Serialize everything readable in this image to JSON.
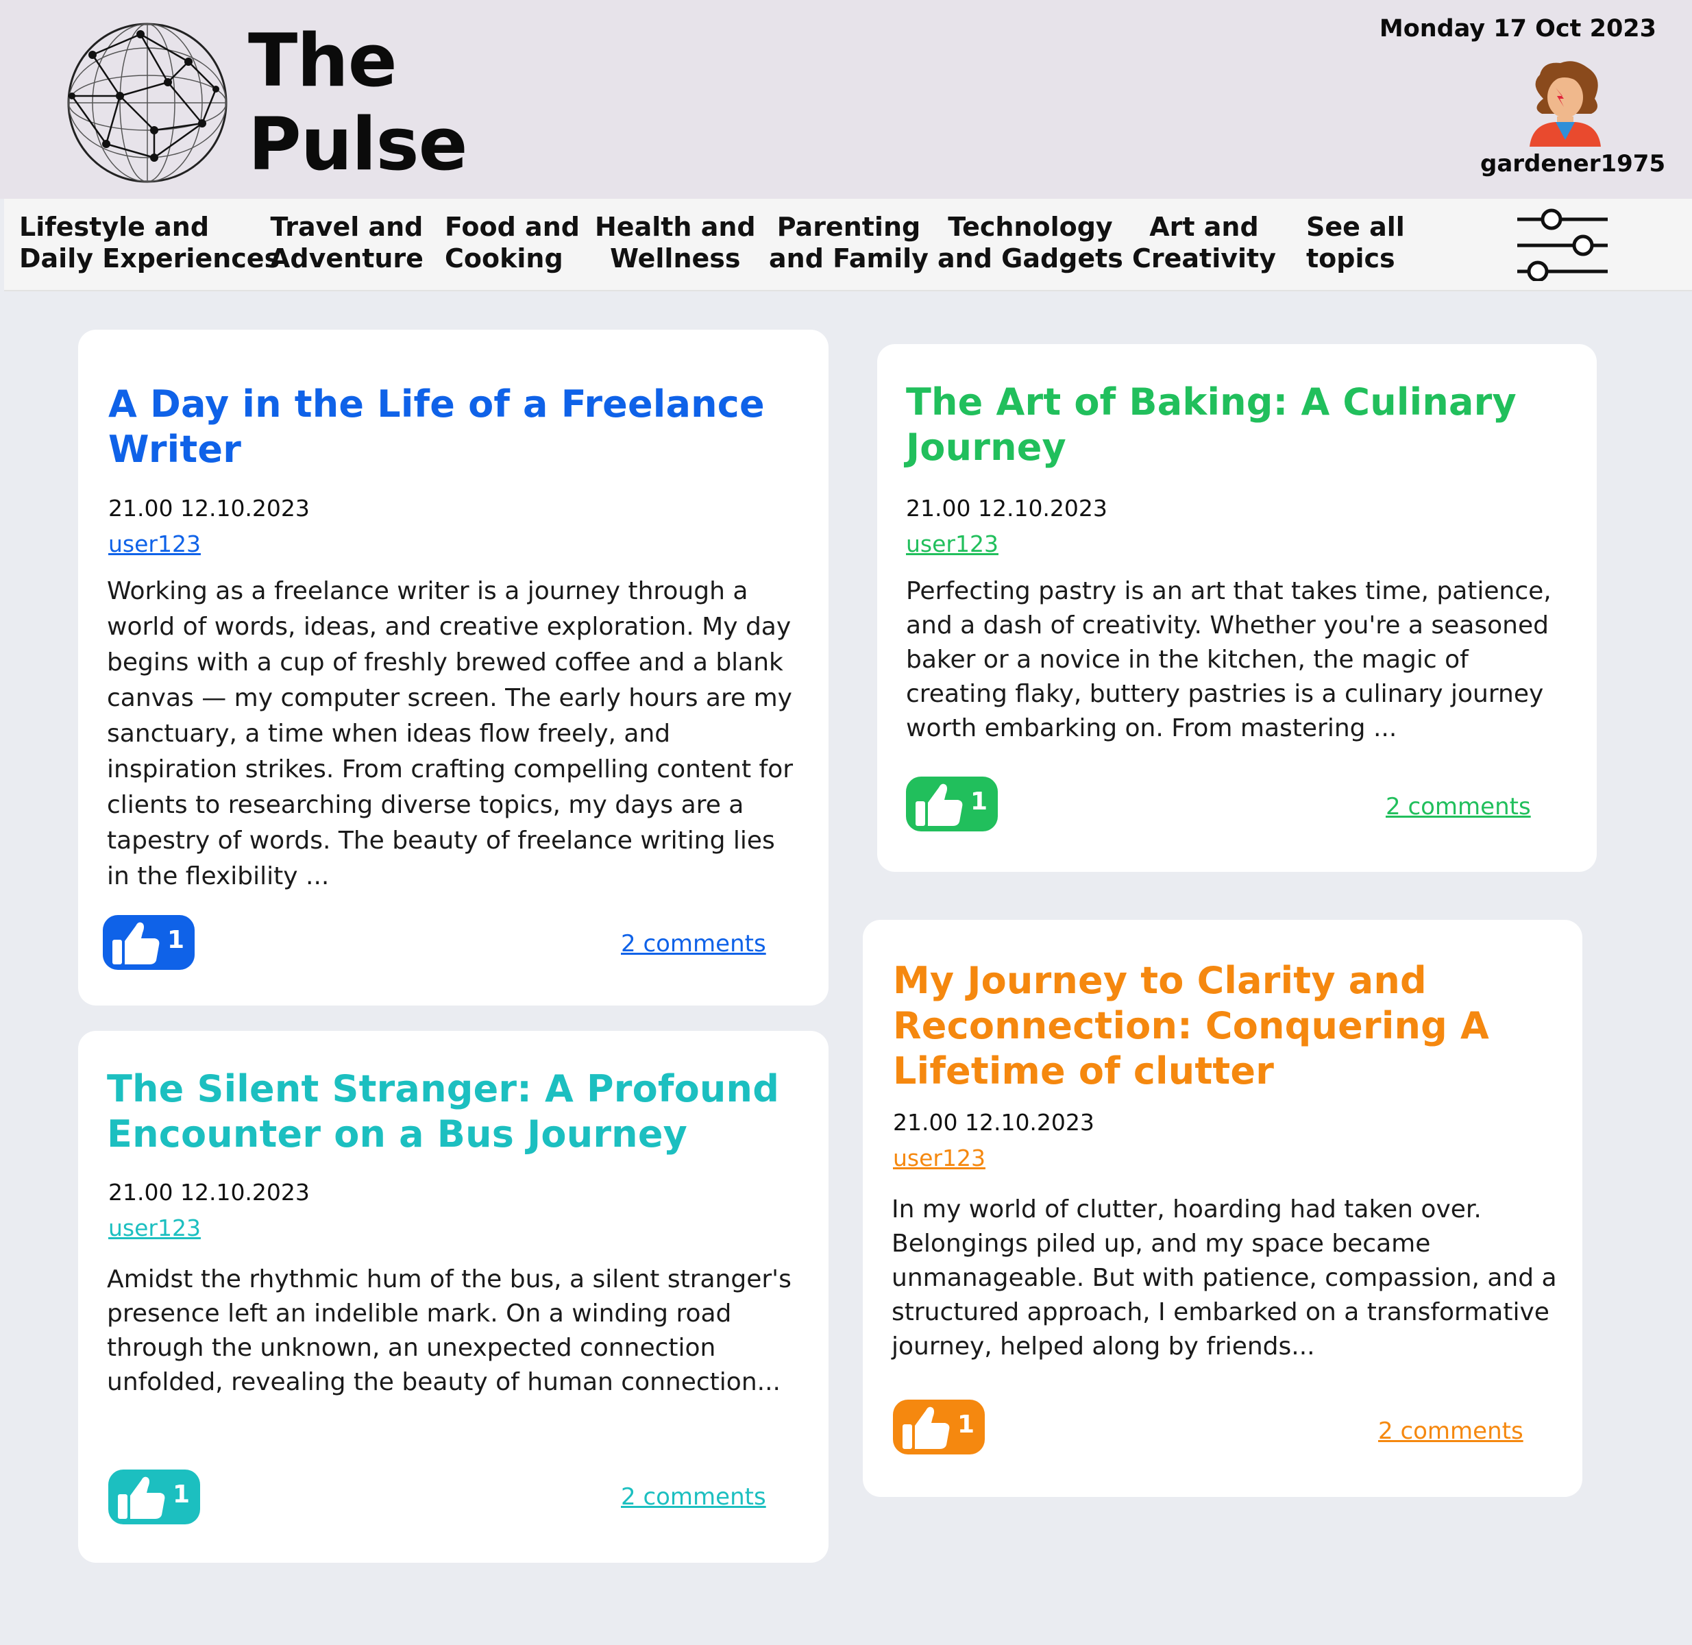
{
  "app": {
    "title_line1": "The",
    "title_line2": "Pulse"
  },
  "header": {
    "date": "Monday 17 Oct 2023",
    "username": "gardener1975"
  },
  "nav": {
    "items": [
      {
        "line1": "Lifestyle and",
        "line2": "Daily Experiences"
      },
      {
        "line1": "Travel and",
        "line2": "Adventure"
      },
      {
        "line1": "Food and",
        "line2": "Cooking"
      },
      {
        "line1": "Health and",
        "line2": "Wellness"
      },
      {
        "line1": "Parenting",
        "line2": "and Family"
      },
      {
        "line1": "Technology",
        "line2": "and Gadgets"
      },
      {
        "line1": "Art and",
        "line2": "Creativity"
      },
      {
        "line1": "See all",
        "line2": "topics"
      }
    ]
  },
  "posts": [
    {
      "title": "A Day in the Life of a Freelance Writer",
      "date": "21.00 12.10.2023",
      "user": "user123",
      "excerpt": "Working as a freelance writer is a journey through a world of words, ideas, and creative exploration. My day begins with a cup of freshly brewed coffee and a blank canvas — my computer screen. The early hours are my sanctuary, a time when ideas flow freely, and inspiration strikes. From crafting compelling content for clients to researching diverse topics, my days are a tapestry of words. The beauty of freelance writing lies in the flexibility ...",
      "likes": "1",
      "comments": "2 comments",
      "color": "#0f62e8"
    },
    {
      "title": "The Art of Baking: A Culinary Journey",
      "date": "21.00 12.10.2023",
      "user": "user123",
      "excerpt": "Perfecting pastry is an art that takes time, patience, and a dash of creativity. Whether you're a seasoned baker or a novice in the kitchen, the magic of creating flaky, buttery pastries is a culinary journey worth embarking on. From mastering ...",
      "likes": "1",
      "comments": "2 comments",
      "color": "#21bf5c"
    },
    {
      "title": "The Silent Stranger: A Profound Encounter on a Bus Journey",
      "date": "21.00 12.10.2023",
      "user": "user123",
      "excerpt": "Amidst the rhythmic hum of the bus, a silent stranger's presence left an indelible mark. On a winding road through the unknown, an unexpected connection unfolded, revealing the beauty of human connection...",
      "likes": "1",
      "comments": "2 comments",
      "color": "#1cbfc0"
    },
    {
      "title": "My Journey to Clarity and Reconnection: Conquering A Lifetime of clutter",
      "date": "21.00 12.10.2023",
      "user": "user123",
      "excerpt": "In my world of clutter, hoarding had taken over. Belongings piled up, and my space became unmanageable. But with patience, compassion, and a structured approach, I embarked on a transformative journey, helped along by friends...",
      "likes": "1",
      "comments": "2 comments",
      "color": "#f5880f"
    }
  ]
}
